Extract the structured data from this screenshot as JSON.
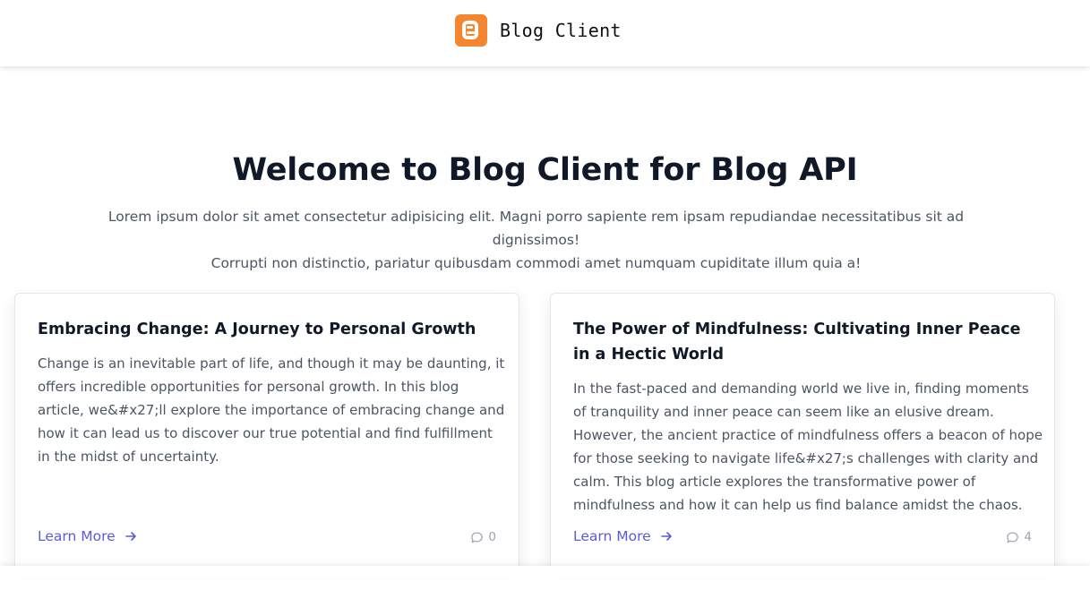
{
  "navbar": {
    "brand_name": "Blog Client",
    "logo_icon": "blogger-icon",
    "logo_color": "#f4862f"
  },
  "hero": {
    "title": "Welcome to Blog Client for Blog API",
    "description_line1": "Lorem ipsum dolor sit amet consectetur adipisicing elit. Magni porro sapiente rem ipsam repudiandae necessitatibus sit ad dignissimos!",
    "description_line2": "Corrupti non distinctio, pariatur quibusdam commodi amet numquam cupiditate illum quia a!"
  },
  "posts": [
    {
      "title": "Embracing Change: A Journey to Personal Growth",
      "excerpt": "Change is an inevitable part of life, and though it may be daunting, it offers incredible opportunities for personal growth. In this blog article, we&#x27;ll explore the importance of embracing change and how it can lead us to discover our true potential and find fulfillment in the midst of uncertainty.",
      "link_label": "Learn More",
      "comment_count": "0"
    },
    {
      "title": "The Power of Mindfulness: Cultivating Inner Peace in a Hectic World",
      "excerpt": "In the fast-paced and demanding world we live in, finding moments of tranquility and inner peace can seem like an elusive dream. However, the ancient practice of mindfulness offers a beacon of hope for those seeking to navigate life&#x27;s challenges with clarity and calm. This blog article explores the transformative power of mindfulness and how it can help us find balance amidst the chaos.",
      "link_label": "Learn More",
      "comment_count": "4"
    }
  ],
  "colors": {
    "link": "#5b5bd6",
    "muted": "#9ca3af",
    "body_text": "#4b5563",
    "heading": "#111827"
  }
}
